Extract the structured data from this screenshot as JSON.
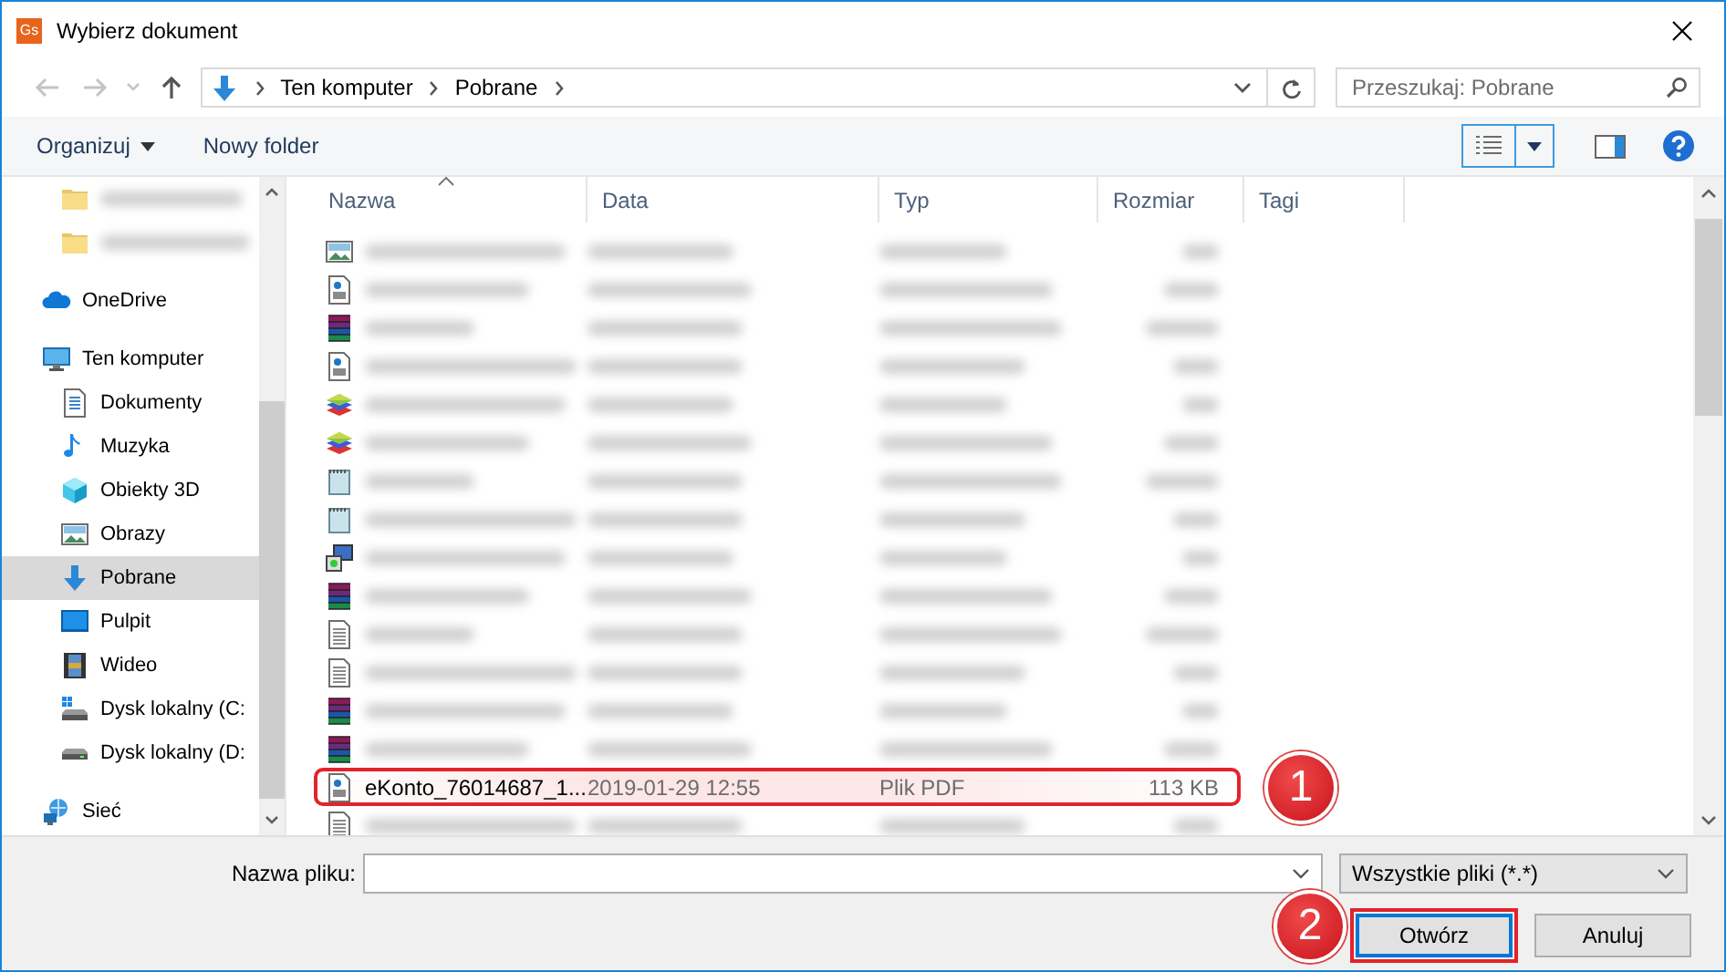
{
  "window": {
    "title": "Wybierz dokument",
    "app_icon": "Gs"
  },
  "address": {
    "path": [
      "Ten komputer",
      "Pobrane"
    ]
  },
  "search": {
    "placeholder": "Przeszukaj: Pobrane"
  },
  "toolbar": {
    "organize": "Organizuj",
    "new_folder": "Nowy folder"
  },
  "sidebar": {
    "items": [
      {
        "kind": "folder",
        "blurred": true,
        "selected": false
      },
      {
        "kind": "folder",
        "blurred": true,
        "selected": false
      },
      {
        "label": "OneDrive",
        "kind": "cloud",
        "selected": false
      },
      {
        "label": "Ten komputer",
        "kind": "computer",
        "selected": false,
        "children": [
          {
            "label": "Dokumenty",
            "kind": "document",
            "selected": false
          },
          {
            "label": "Muzyka",
            "kind": "music",
            "selected": false
          },
          {
            "label": "Obiekty 3D",
            "kind": "cube",
            "selected": false
          },
          {
            "label": "Obrazy",
            "kind": "image",
            "selected": false
          },
          {
            "label": "Pobrane",
            "kind": "download",
            "selected": true
          },
          {
            "label": "Pulpit",
            "kind": "desktop",
            "selected": false
          },
          {
            "label": "Wideo",
            "kind": "film",
            "selected": false
          },
          {
            "label": "Dysk lokalny (C:",
            "kind": "system-drive",
            "selected": false
          },
          {
            "label": "Dysk lokalny (D:",
            "kind": "drive",
            "selected": false
          }
        ]
      },
      {
        "label": "Sieć",
        "kind": "network",
        "selected": false
      }
    ]
  },
  "table": {
    "columns": [
      {
        "label": "Nazwa",
        "sorted": true
      },
      {
        "label": "Data",
        "sorted": false
      },
      {
        "label": "Typ",
        "sorted": false
      },
      {
        "label": "Rozmiar",
        "sorted": false
      },
      {
        "label": "Tagi",
        "sorted": false
      }
    ],
    "rows": [
      {
        "kind": "image",
        "blurred": true,
        "highlighted": false
      },
      {
        "kind": "pdf",
        "blurred": true,
        "highlighted": false
      },
      {
        "kind": "archive",
        "blurred": true,
        "highlighted": false
      },
      {
        "kind": "pdf",
        "blurred": true,
        "highlighted": false
      },
      {
        "kind": "package",
        "blurred": true,
        "highlighted": false
      },
      {
        "kind": "package",
        "blurred": true,
        "highlighted": false
      },
      {
        "kind": "notepad",
        "blurred": true,
        "highlighted": false
      },
      {
        "kind": "notepad",
        "blurred": true,
        "highlighted": false
      },
      {
        "kind": "installer",
        "blurred": true,
        "highlighted": false
      },
      {
        "kind": "archive",
        "blurred": true,
        "highlighted": false
      },
      {
        "kind": "text",
        "blurred": true,
        "highlighted": false
      },
      {
        "kind": "text",
        "blurred": true,
        "highlighted": false
      },
      {
        "kind": "archive",
        "blurred": true,
        "highlighted": false
      },
      {
        "kind": "archive",
        "blurred": true,
        "highlighted": false
      },
      {
        "kind": "pdf",
        "blurred": false,
        "highlighted": true,
        "cells": [
          "eKonto_76014687_1...",
          "2019-01-29 12:55",
          "Plik PDF",
          "113 KB"
        ]
      },
      {
        "kind": "text",
        "blurred": true,
        "highlighted": false
      }
    ]
  },
  "footer": {
    "filename_label": "Nazwa pliku:",
    "filter": "Wszystkie pliki (*.*)",
    "buttons": [
      {
        "label": "Otwórz",
        "default": true
      },
      {
        "label": "Anuluj",
        "default": false
      }
    ]
  },
  "annotations": [
    {
      "label": "1"
    },
    {
      "label": "2"
    }
  ]
}
